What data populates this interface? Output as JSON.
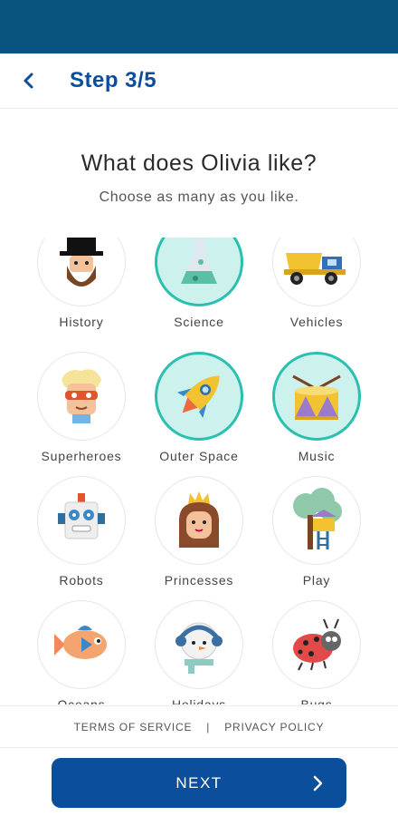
{
  "header": {
    "step_title": "Step 3/5",
    "back_icon": "chevron-left-icon"
  },
  "main": {
    "heading": "What does Olivia like?",
    "subheading": "Choose as many as you like.",
    "interests": [
      {
        "label": "History",
        "icon": "history-icon",
        "selected": false
      },
      {
        "label": "Science",
        "icon": "science-icon",
        "selected": true
      },
      {
        "label": "Vehicles",
        "icon": "vehicles-icon",
        "selected": false
      },
      {
        "label": "Superheroes",
        "icon": "superheroes-icon",
        "selected": false
      },
      {
        "label": "Outer Space",
        "icon": "outer-space-icon",
        "selected": true
      },
      {
        "label": "Music",
        "icon": "music-icon",
        "selected": true
      },
      {
        "label": "Robots",
        "icon": "robots-icon",
        "selected": false
      },
      {
        "label": "Princesses",
        "icon": "princesses-icon",
        "selected": false
      },
      {
        "label": "Play",
        "icon": "play-icon",
        "selected": false
      },
      {
        "label": "Oceans",
        "icon": "oceans-icon",
        "selected": false
      },
      {
        "label": "Holidays",
        "icon": "holidays-icon",
        "selected": false
      },
      {
        "label": "Bugs",
        "icon": "bugs-icon",
        "selected": false
      }
    ]
  },
  "footer": {
    "terms": "TERMS OF SERVICE",
    "separator": "|",
    "privacy": "PRIVACY POLICY",
    "next_label": "NEXT",
    "next_icon": "chevron-right-icon"
  },
  "colors": {
    "status_bar": "#08537f",
    "primary": "#0b4f9c",
    "selected_ring": "#2bbfb0",
    "selected_fill": "#cdf1ec"
  }
}
